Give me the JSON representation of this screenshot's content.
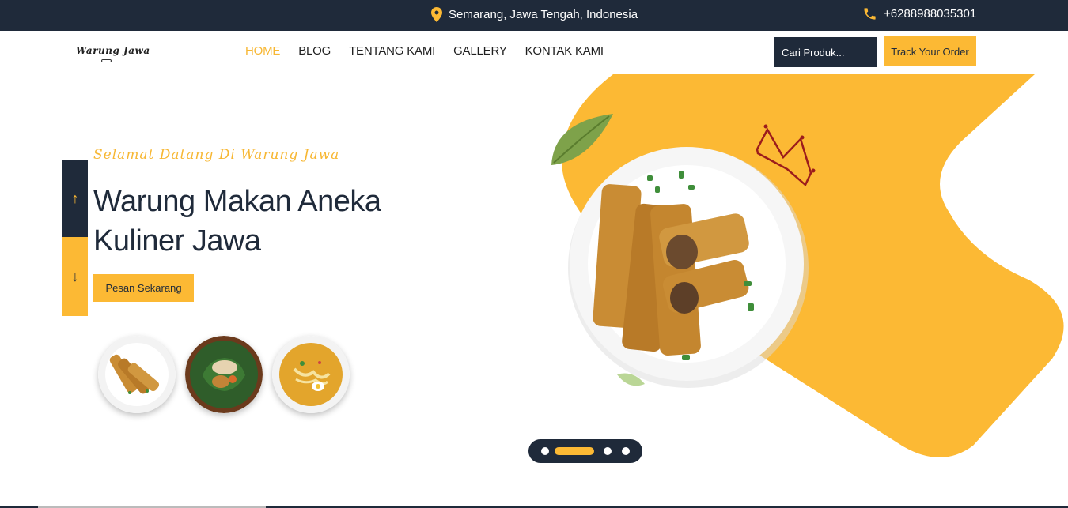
{
  "topbar": {
    "location": "Semarang, Jawa Tengah, Indonesia",
    "phone": "+6288988035301",
    "location_icon": "map-pin-icon",
    "phone_icon": "phone-icon"
  },
  "header": {
    "logo_text": "Warung Jawa",
    "nav": [
      {
        "label": "HOME",
        "active": true
      },
      {
        "label": "BLOG",
        "active": false
      },
      {
        "label": "TENTANG KAMI",
        "active": false
      },
      {
        "label": "GALLERY",
        "active": false
      },
      {
        "label": "KONTAK KAMI",
        "active": false
      }
    ],
    "search_placeholder": "Cari Produk...",
    "track_label": "Track Your Order"
  },
  "hero": {
    "greeting": "Selamat Datang Di Warung Jawa",
    "title": "Warung Makan Aneka Kuliner Jawa",
    "cta_label": "Pesan Sekarang",
    "slider_up_icon": "arrow-up-icon",
    "slider_down_icon": "arrow-down-icon",
    "thumbnails": [
      "spring-rolls-thumb",
      "pecel-thumb",
      "soto-thumb"
    ],
    "main_image": "spring-rolls-plate",
    "slides_total": 4,
    "active_slide": 2
  },
  "colors": {
    "dark": "#1f2a3a",
    "accent": "#fcb934",
    "white": "#ffffff"
  }
}
